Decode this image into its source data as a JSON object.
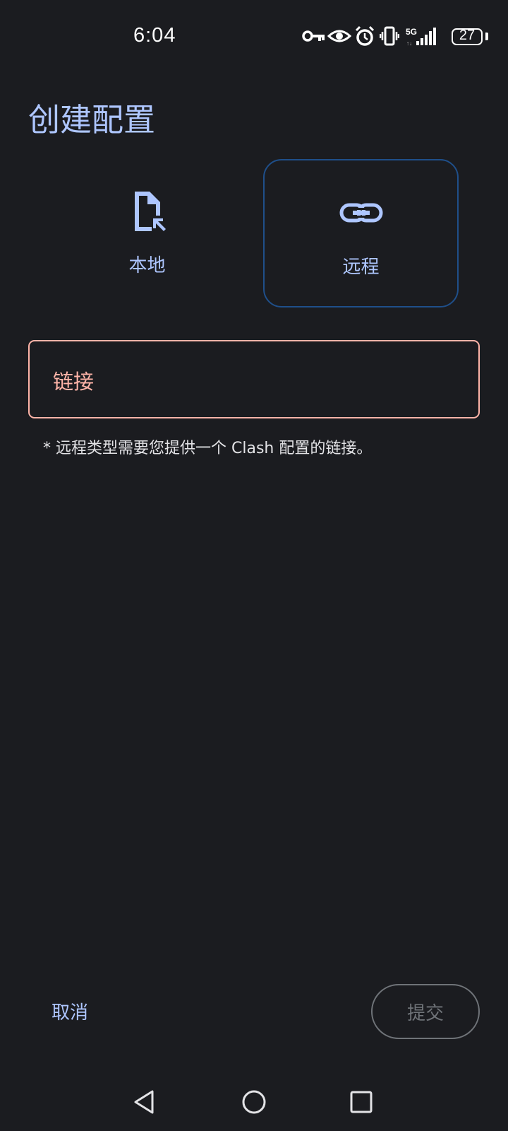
{
  "status_bar": {
    "time": "6:04",
    "battery": "27",
    "icons": [
      "vpn-key-icon",
      "eye-icon",
      "alarm-icon",
      "vibrate-icon",
      "signal-5g-icon",
      "battery-icon"
    ],
    "network": "5G"
  },
  "page": {
    "title": "创建配置"
  },
  "types": {
    "local": {
      "label": "本地",
      "icon": "file-import-icon"
    },
    "remote": {
      "label": "远程",
      "icon": "link-icon",
      "selected": true
    }
  },
  "url_field": {
    "label": "链接",
    "value": ""
  },
  "hint": "* 远程类型需要您提供一个 Clash 配置的链接。",
  "actions": {
    "cancel": "取消",
    "submit": "提交"
  },
  "colors": {
    "background": "#1b1c20",
    "accent": "#aec6ff",
    "error": "#ffb4a8",
    "selected_border": "#1f4f8a",
    "disabled": "#6f7378"
  },
  "nav": [
    "back-icon",
    "home-icon",
    "recents-icon"
  ]
}
